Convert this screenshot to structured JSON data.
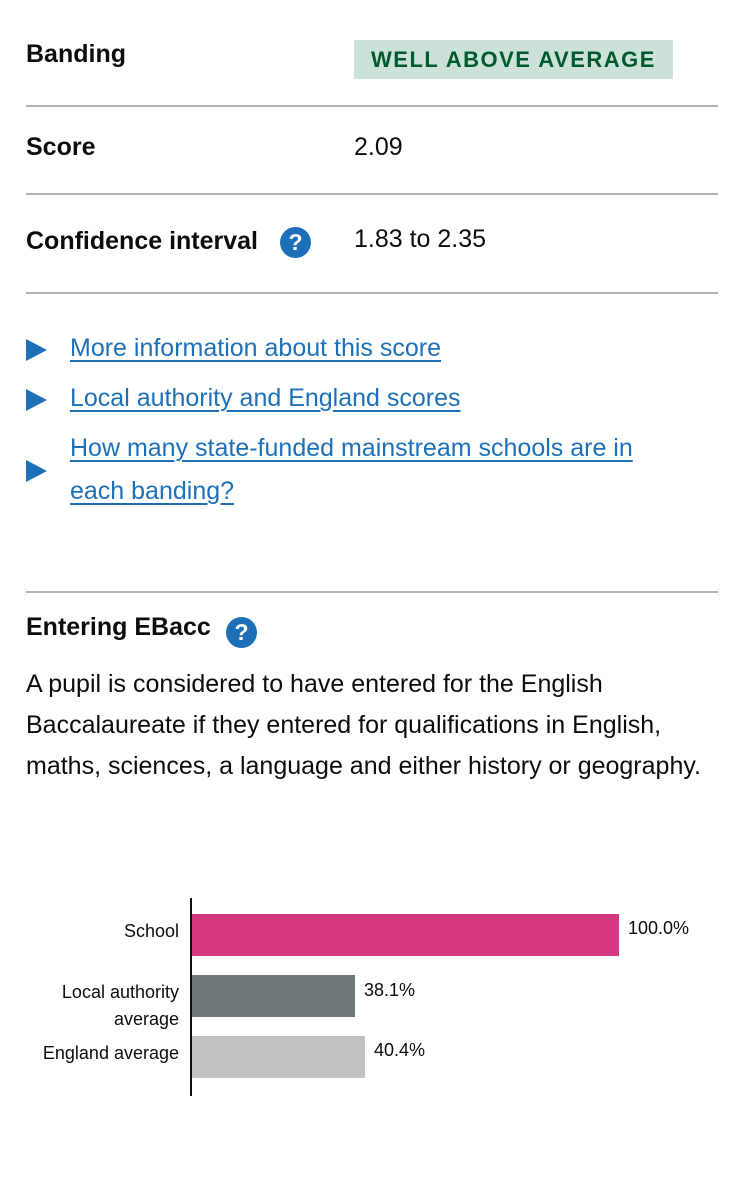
{
  "summary": {
    "banding": {
      "key": "Banding",
      "value": "WELL ABOVE AVERAGE",
      "tag_bg": "#cce2d8",
      "tag_fg": "#005a30"
    },
    "score": {
      "key": "Score",
      "value": "2.09"
    },
    "confidence": {
      "key": "Confidence interval",
      "value": "1.83 to 2.35",
      "help_icon": "question-circle-icon"
    }
  },
  "details": [
    {
      "label": "More information about this score"
    },
    {
      "label": "Local authority and England scores"
    },
    {
      "label_line1": "How many state-funded mainstream schools are in",
      "label_line2": "each banding?"
    }
  ],
  "ebacc": {
    "heading": "Entering EBacc",
    "help_icon": "question-circle-icon",
    "description": "A pupil is considered to have entered for the English Baccalaureate if they entered for qualifications in English, maths, sciences, a language and either history or geography."
  },
  "chart_data": {
    "type": "bar",
    "orientation": "horizontal",
    "categories": [
      "School",
      "Local authority average",
      "England average"
    ],
    "values": [
      100.0,
      38.1,
      40.4
    ],
    "value_labels": [
      "100.0%",
      "38.1%",
      "40.4%"
    ],
    "colors": [
      "#d53880",
      "#6f777b",
      "#bfc1c3"
    ],
    "xlim": [
      0,
      100
    ]
  },
  "colors": {
    "link": "#1d70b8",
    "divider": "#b1b4b6",
    "text": "#0b0c0c"
  }
}
